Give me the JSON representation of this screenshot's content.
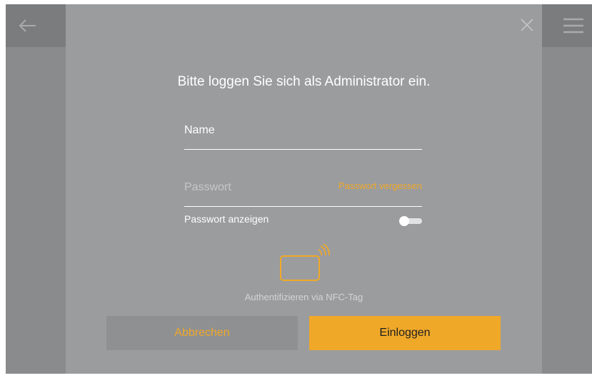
{
  "colors": {
    "accent": "#f0a829",
    "screen_bg": "#8a8b8d",
    "dialog_bg": "#9b9c9e"
  },
  "topbar": {
    "back_icon": "arrow-left-icon",
    "menu_icon": "hamburger-menu-icon"
  },
  "dialog": {
    "close_icon": "close-icon",
    "title": "Bitte loggen Sie sich als Administrator ein.",
    "name_field": {
      "placeholder": "Name",
      "value": ""
    },
    "password_field": {
      "placeholder": "Passwort",
      "value": ""
    },
    "forgot_password": "Passwort vergessen",
    "show_password": {
      "label": "Passwort anzeigen",
      "enabled": false
    },
    "nfc": {
      "icon": "nfc-card-icon",
      "label": "Authentifizieren via NFC-Tag"
    },
    "buttons": {
      "cancel": "Abbrechen",
      "login": "Einloggen"
    }
  }
}
